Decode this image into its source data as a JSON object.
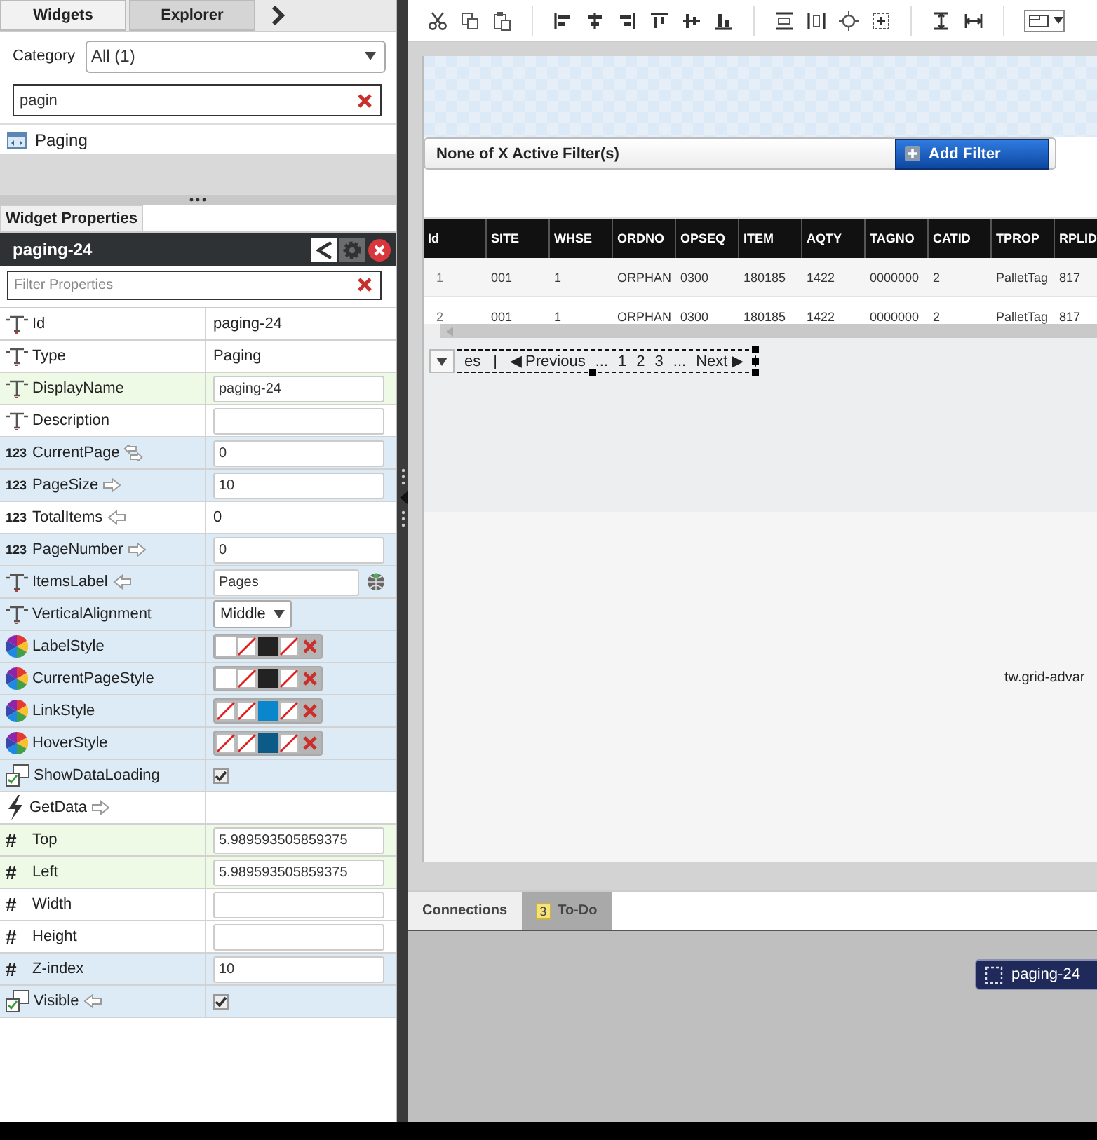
{
  "left_panel": {
    "tabs": [
      {
        "label": "Widgets",
        "selected": true
      },
      {
        "label": "Explorer",
        "selected": false
      }
    ],
    "category": {
      "label": "Category",
      "value": "All (1)"
    },
    "search": {
      "value": "pagin"
    },
    "widgets": [
      {
        "label": "Paging"
      }
    ],
    "properties_tab": "Widget Properties",
    "widget_name": "paging-24",
    "filter": {
      "placeholder": "Filter Properties"
    },
    "properties": [
      {
        "name": "Id",
        "kind": "string",
        "editor": {
          "kind": "text",
          "value": "paging-24"
        },
        "color": "#ffffff"
      },
      {
        "name": "Type",
        "kind": "string",
        "editor": {
          "kind": "text",
          "value": "Paging"
        },
        "color": "#ffffff"
      },
      {
        "name": "DisplayName",
        "kind": "string",
        "editor": {
          "kind": "input",
          "value": "paging-24"
        },
        "color": "#eefae6"
      },
      {
        "name": "Description",
        "kind": "string",
        "editor": {
          "kind": "input"
        },
        "color": "#ffffff"
      },
      {
        "name": "CurrentPage",
        "kind": "number",
        "glyph": "123",
        "bind_in": true,
        "bind_out": true,
        "editor": {
          "kind": "input",
          "value": "0"
        },
        "color": "#ddebf7"
      },
      {
        "name": "PageSize",
        "kind": "number",
        "glyph": "123",
        "bind_in": false,
        "bind_out": true,
        "editor": {
          "kind": "input",
          "value": "10"
        },
        "color": "#ddebf7"
      },
      {
        "name": "TotalItems",
        "kind": "number",
        "glyph": "123",
        "bind_in": true,
        "bind_out": false,
        "editor": {
          "kind": "text",
          "value": "0"
        },
        "color": "#ffffff"
      },
      {
        "name": "PageNumber",
        "kind": "number",
        "glyph": "123",
        "bind_in": false,
        "bind_out": true,
        "editor": {
          "kind": "input",
          "value": "0"
        },
        "color": "#ddebf7"
      },
      {
        "name": "ItemsLabel",
        "kind": "string",
        "bind_in": true,
        "bind_out": false,
        "editor": {
          "kind": "localized",
          "value": "Pages"
        },
        "color": "#ddebf7"
      },
      {
        "name": "VerticalAlignment",
        "kind": "string",
        "editor": {
          "kind": "select",
          "value": "Middle"
        },
        "color": "#ddebf7"
      },
      {
        "name": "LabelStyle",
        "kind": "style",
        "editor": {
          "kind": "style",
          "swatches": [
            {
              "kind": "fill",
              "color": "#ffffff"
            },
            {
              "kind": "none"
            },
            {
              "kind": "fill",
              "color": "#222222"
            },
            {
              "kind": "none"
            }
          ]
        },
        "color": "#ddebf7"
      },
      {
        "name": "CurrentPageStyle",
        "kind": "style",
        "editor": {
          "kind": "style",
          "swatches": [
            {
              "kind": "fill",
              "color": "#ffffff"
            },
            {
              "kind": "none"
            },
            {
              "kind": "fill",
              "color": "#222222"
            },
            {
              "kind": "none"
            }
          ]
        },
        "color": "#ddebf7"
      },
      {
        "name": "LinkStyle",
        "kind": "style",
        "editor": {
          "kind": "style",
          "swatches": [
            {
              "kind": "none"
            },
            {
              "kind": "none"
            },
            {
              "kind": "fill",
              "color": "#0a86cc"
            },
            {
              "kind": "none"
            }
          ]
        },
        "color": "#ddebf7"
      },
      {
        "name": "HoverStyle",
        "kind": "style",
        "editor": {
          "kind": "style",
          "swatches": [
            {
              "kind": "none"
            },
            {
              "kind": "none"
            },
            {
              "kind": "fill",
              "color": "#0b5a87"
            },
            {
              "kind": "none"
            }
          ]
        },
        "color": "#ddebf7"
      },
      {
        "name": "ShowDataLoading",
        "kind": "boolean",
        "editor": {
          "kind": "checkbox",
          "checked": true
        },
        "color": "#ddebf7"
      },
      {
        "name": "GetData",
        "kind": "event",
        "bind_in": false,
        "bind_out": true,
        "color": "#ffffff"
      },
      {
        "name": "Top",
        "kind": "hash",
        "glyph": "#",
        "editor": {
          "kind": "input",
          "value": "5.989593505859375"
        },
        "color": "#eefae6"
      },
      {
        "name": "Left",
        "kind": "hash",
        "glyph": "#",
        "editor": {
          "kind": "input",
          "value": "5.989593505859375"
        },
        "color": "#eefae6"
      },
      {
        "name": "Width",
        "kind": "hash",
        "glyph": "#",
        "editor": {
          "kind": "input"
        },
        "color": "#ffffff"
      },
      {
        "name": "Height",
        "kind": "hash",
        "glyph": "#",
        "editor": {
          "kind": "input"
        },
        "color": "#ffffff"
      },
      {
        "name": "Z-index",
        "kind": "hash",
        "glyph": "#",
        "editor": {
          "kind": "input",
          "value": "10"
        },
        "color": "#ddebf7"
      },
      {
        "name": "Visible",
        "kind": "boolean",
        "bind_in": true,
        "bind_out": false,
        "editor": {
          "kind": "checkbox",
          "checked": true
        },
        "color": "#ddebf7"
      }
    ]
  },
  "canvas": {
    "filter_bar": {
      "text": "None of X Active Filter(s)",
      "button": "Add Filter"
    },
    "grid": {
      "columns": [
        "Id",
        "SITE",
        "WHSE",
        "ORDNO",
        "OPSEQ",
        "ITEM",
        "AQTY",
        "TAGNO",
        "CATID",
        "TPROP",
        "RPLID"
      ],
      "rows": [
        [
          "1",
          "001",
          "1",
          "ORPHAN",
          "0300",
          "180185",
          "1422",
          "0000000",
          "2",
          "PalletTag",
          "817"
        ],
        [
          "2",
          "001",
          "1",
          "ORPHAN",
          "0300",
          "180185",
          "1422",
          "0000000",
          "2",
          "PalletTag",
          "817"
        ]
      ]
    },
    "pager": {
      "items_label": "es",
      "separator": "|",
      "previous": "◀ Previous",
      "pages": [
        "...",
        "1",
        "2",
        "3",
        "..."
      ],
      "next": "Next ▶"
    },
    "class_label": "tw.grid-advar"
  },
  "bottom_tabs": [
    {
      "label": "Connections",
      "selected": true
    },
    {
      "label": "To-Do",
      "badge": "3",
      "selected": false
    }
  ],
  "connections": [
    {
      "label": "paging-24"
    }
  ]
}
